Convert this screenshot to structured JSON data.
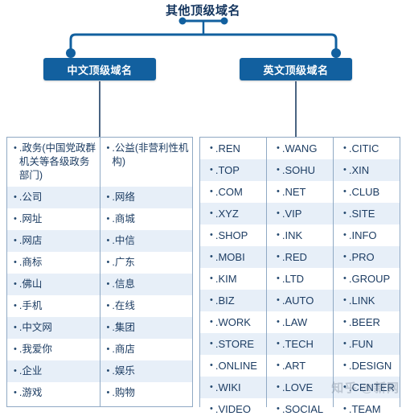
{
  "title": "其他顶级域名",
  "colors": {
    "box_fill": "#12609f",
    "connector": "#12609f",
    "table_border": "#8fa9c4",
    "row_alt": "#e7eff8",
    "text": "#1d3d63",
    "title": "#14355e"
  },
  "branches": [
    {
      "id": "chinese",
      "label": "中文顶级域名"
    },
    {
      "id": "english",
      "label": "英文顶级域名"
    }
  ],
  "chinese_table": {
    "columns": [
      {
        "items": [
          ".政务(中国党政群机关等各级政务部门)",
          ".公司",
          ".网址",
          ".网店",
          ".商标",
          ".佛山",
          ".手机",
          ".中文网",
          ".我爱你",
          ".企业",
          ".游戏"
        ]
      },
      {
        "items": [
          ".公益(非营利性机构)",
          ".网络",
          ".商城",
          ".中信",
          ".广东",
          ".信息",
          ".在线",
          ".集团",
          ".商店",
          ".娱乐",
          ".购物"
        ]
      }
    ]
  },
  "english_table": {
    "columns": [
      {
        "items": [
          ".REN",
          ".TOP",
          ".COM",
          ".XYZ",
          ".SHOP",
          ".MOBI",
          ".KIM",
          ".BIZ",
          ".WORK",
          ".STORE",
          ".ONLINE",
          ".WIKI",
          ".VIDEO"
        ]
      },
      {
        "items": [
          ".WANG",
          ".SOHU",
          ".NET",
          ".VIP",
          ".INK",
          ".RED",
          ".LTD",
          ".AUTO",
          ".LAW",
          ".TECH",
          ".ART",
          ".LOVE",
          ".SOCIAL"
        ]
      },
      {
        "items": [
          ".CITIC",
          ".XIN",
          ".CLUB",
          ".SITE",
          ".INFO",
          ".PRO",
          ".GROUP",
          ".LINK",
          ".BEER",
          ".FUN",
          ".DESIGN",
          ".CENTER",
          ".TEAM"
        ]
      }
    ]
  },
  "watermark": "知乎 @新网",
  "bullet_glyph": "•"
}
